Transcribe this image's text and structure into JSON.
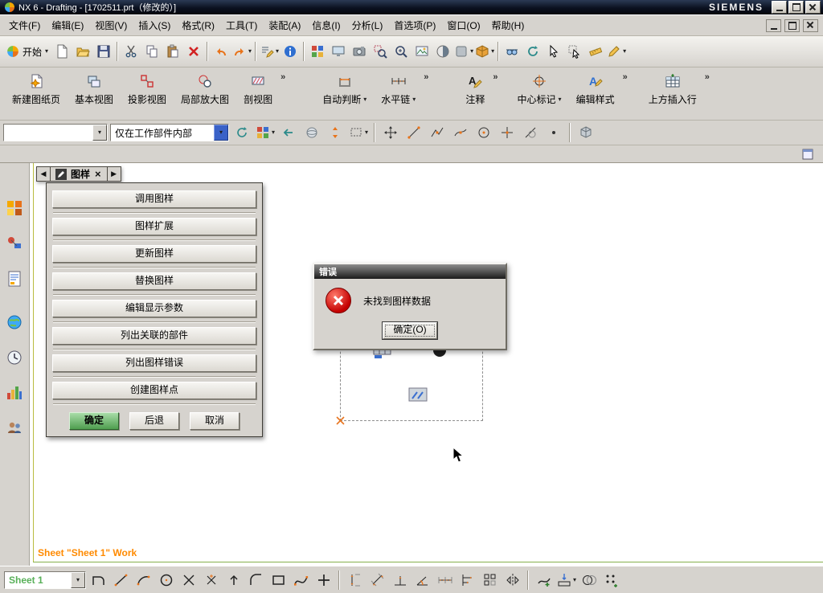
{
  "titlebar": {
    "title": "NX 6 - Drafting - [1702511.prt（修改的）]",
    "brand": "SIEMENS"
  },
  "glyphs": {
    "dropdown": "▾",
    "overflow": "»",
    "back": "◀",
    "forward": "▶",
    "close": "×"
  },
  "menubar": {
    "items": [
      "文件(F)",
      "编辑(E)",
      "视图(V)",
      "插入(S)",
      "格式(R)",
      "工具(T)",
      "装配(A)",
      "信息(I)",
      "分析(L)",
      "首选项(P)",
      "窗口(O)",
      "帮助(H)"
    ]
  },
  "toolbar_main": {
    "start_label": "开始"
  },
  "ribbon": {
    "buttons": [
      {
        "label": "新建图纸页"
      },
      {
        "label": "基本视图"
      },
      {
        "label": "投影视图"
      },
      {
        "label": "局部放大图"
      },
      {
        "label": "剖视图"
      },
      {
        "label": "自动判断"
      },
      {
        "label": "水平链"
      },
      {
        "label": "注释"
      },
      {
        "label": "中心标记"
      },
      {
        "label": "编辑样式"
      },
      {
        "label": "上方插入行"
      }
    ]
  },
  "selection_bar": {
    "filter_value": "",
    "scope_value": "仅在工作部件内部"
  },
  "dialog_rail": {
    "tab_label": "图样"
  },
  "panel": {
    "buttons": [
      "调用图样",
      "图样扩展",
      "更新图样",
      "替换图样",
      "编辑显示参数",
      "列出关联的部件",
      "列出图样错误",
      "创建图样点"
    ],
    "ok_label": "确定",
    "back_label": "后退",
    "cancel_label": "取消"
  },
  "error_dialog": {
    "title": "错误",
    "message": "未找到图样数据",
    "ok_label": "确定(O)"
  },
  "canvas": {
    "status_text": "Sheet \"Sheet 1\" Work"
  },
  "bottombar": {
    "sheet_value": "Sheet 1"
  },
  "icon_names": {
    "toolbar_main": [
      "nx-start-icon",
      "new-file-icon",
      "open-file-icon",
      "save-icon",
      "cut-icon",
      "copy-icon",
      "paste-icon",
      "delete-icon",
      "undo-icon",
      "redo-icon",
      "repeat-command-icon",
      "information-icon",
      "window-layout-icon",
      "display-part-icon",
      "snapshot-icon",
      "zoom-area-icon",
      "zoom-icon",
      "fit-view-icon",
      "shaded-view-icon",
      "rendering-style-icon",
      "orient-view-icon",
      "stereo-glasses-icon",
      "rotate-view-icon",
      "select-arrow-icon",
      "selection-filter-icon",
      "measure-icon",
      "annotation-pencil-icon"
    ],
    "resource_bar": [
      "assembly-navigator-icon",
      "constraint-navigator-icon",
      "part-navigator-icon",
      "reuse-library-icon",
      "history-icon",
      "visual-reports-icon",
      "roles-icon"
    ],
    "bottom_tools": [
      "profile-icon",
      "line-icon",
      "arc-icon",
      "circle-icon",
      "derived-point-icon",
      "point-icon",
      "extend-icon",
      "fillet-icon",
      "rectangle-icon",
      "studio-spline-icon",
      "point-plus-icon",
      "vertical-dimension-icon",
      "parallel-dimension-icon",
      "perpendicular-dimension-icon",
      "angular-dimension-icon",
      "chain-dimension-icon",
      "baseline-dimension-icon",
      "pattern-curve-icon",
      "mirror-curve-icon",
      "add-curve-icon",
      "project-curve-icon",
      "intersection-curve-icon",
      "pattern-grid-icon"
    ]
  }
}
